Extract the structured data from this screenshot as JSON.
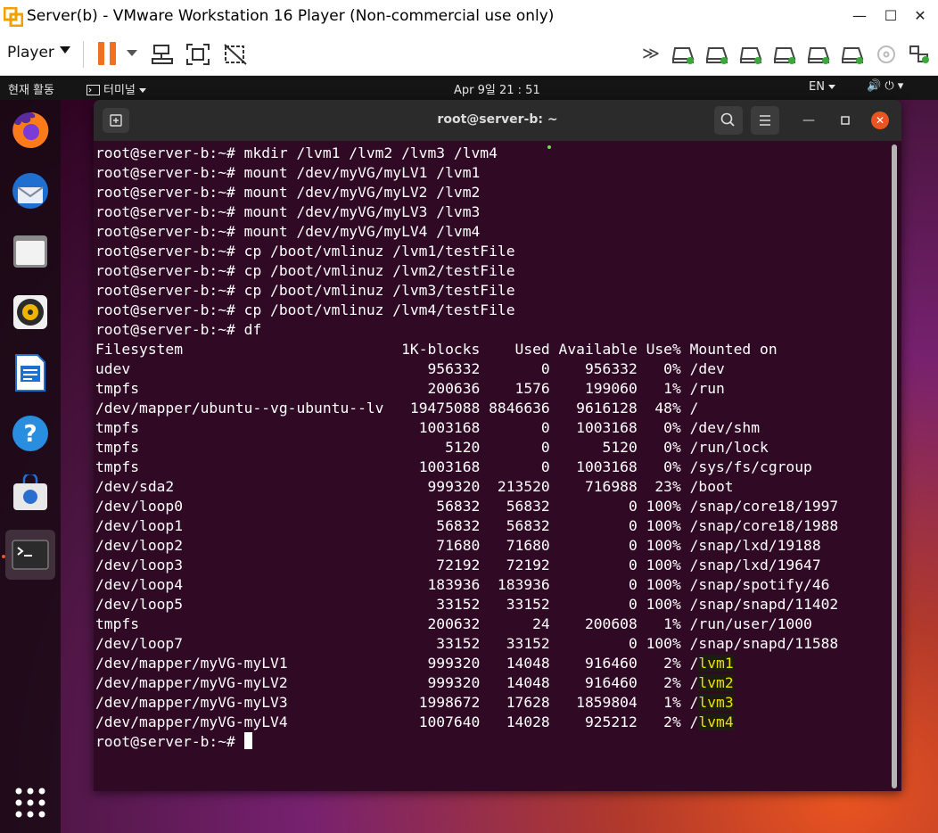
{
  "vmware": {
    "title": "Server(b) - VMware Workstation 16 Player (Non-commercial use only)",
    "player_label": "Player",
    "minimize": "—",
    "maximize": "☐",
    "close": "✕",
    "fastforward": "≫"
  },
  "topbar": {
    "activities": "현재 활동",
    "terminal_label": "터미널",
    "clock": "Apr 9일  21 : 51",
    "lang": "EN",
    "sys": "🔊  ⏻ ▾"
  },
  "terminal": {
    "title": "root@server-b: ~",
    "min": "—",
    "close": "✕",
    "prompt": "root@server-b:~# ",
    "commands": [
      "mkdir /lvm1 /lvm2 /lvm3 /lvm4",
      "mount /dev/myVG/myLV1 /lvm1",
      "mount /dev/myVG/myLV2 /lvm2",
      "mount /dev/myVG/myLV3 /lvm3",
      "mount /dev/myVG/myLV4 /lvm4",
      "cp /boot/vmlinuz /lvm1/testFile",
      "cp /boot/vmlinuz /lvm2/testFile",
      "cp /boot/vmlinuz /lvm3/testFile",
      "cp /boot/vmlinuz /lvm4/testFile",
      "df"
    ],
    "df_header": [
      "Filesystem",
      "1K-blocks",
      "Used",
      "Available",
      "Use%",
      "Mounted on"
    ],
    "df_rows": [
      [
        "udev",
        "956332",
        "0",
        "956332",
        "0%",
        "/dev"
      ],
      [
        "tmpfs",
        "200636",
        "1576",
        "199060",
        "1%",
        "/run"
      ],
      [
        "/dev/mapper/ubuntu--vg-ubuntu--lv",
        "19475088",
        "8846636",
        "9616128",
        "48%",
        "/"
      ],
      [
        "tmpfs",
        "1003168",
        "0",
        "1003168",
        "0%",
        "/dev/shm"
      ],
      [
        "tmpfs",
        "5120",
        "0",
        "5120",
        "0%",
        "/run/lock"
      ],
      [
        "tmpfs",
        "1003168",
        "0",
        "1003168",
        "0%",
        "/sys/fs/cgroup"
      ],
      [
        "/dev/sda2",
        "999320",
        "213520",
        "716988",
        "23%",
        "/boot"
      ],
      [
        "/dev/loop0",
        "56832",
        "56832",
        "0",
        "100%",
        "/snap/core18/1997"
      ],
      [
        "/dev/loop1",
        "56832",
        "56832",
        "0",
        "100%",
        "/snap/core18/1988"
      ],
      [
        "/dev/loop2",
        "71680",
        "71680",
        "0",
        "100%",
        "/snap/lxd/19188"
      ],
      [
        "/dev/loop3",
        "72192",
        "72192",
        "0",
        "100%",
        "/snap/lxd/19647"
      ],
      [
        "/dev/loop4",
        "183936",
        "183936",
        "0",
        "100%",
        "/snap/spotify/46"
      ],
      [
        "/dev/loop5",
        "33152",
        "33152",
        "0",
        "100%",
        "/snap/snapd/11402"
      ],
      [
        "tmpfs",
        "200632",
        "24",
        "200608",
        "1%",
        "/run/user/1000"
      ],
      [
        "/dev/loop7",
        "33152",
        "33152",
        "0",
        "100%",
        "/snap/snapd/11588"
      ],
      [
        "/dev/mapper/myVG-myLV1",
        "999320",
        "14048",
        "916460",
        "2%",
        "/lvm1"
      ],
      [
        "/dev/mapper/myVG-myLV2",
        "999320",
        "14048",
        "916460",
        "2%",
        "/lvm2"
      ],
      [
        "/dev/mapper/myVG-myLV3",
        "1998672",
        "17628",
        "1859804",
        "1%",
        "/lvm3"
      ],
      [
        "/dev/mapper/myVG-myLV4",
        "1007640",
        "14028",
        "925212",
        "2%",
        "/lvm4"
      ]
    ],
    "highlight_mounts": [
      "/lvm1",
      "/lvm2",
      "/lvm3",
      "/lvm4"
    ]
  },
  "dock": [
    {
      "name": "firefox-icon"
    },
    {
      "name": "thunderbird-icon"
    },
    {
      "name": "files-icon"
    },
    {
      "name": "rhythmbox-icon"
    },
    {
      "name": "libreoffice-writer-icon"
    },
    {
      "name": "help-icon"
    },
    {
      "name": "software-icon"
    },
    {
      "name": "terminal-icon"
    },
    {
      "name": "show-apps-icon"
    }
  ],
  "colors": {
    "terminal_bg": "#300a24",
    "accent": "#e95420",
    "pause": "#f07121",
    "mount_highlight": "#f0e000"
  }
}
